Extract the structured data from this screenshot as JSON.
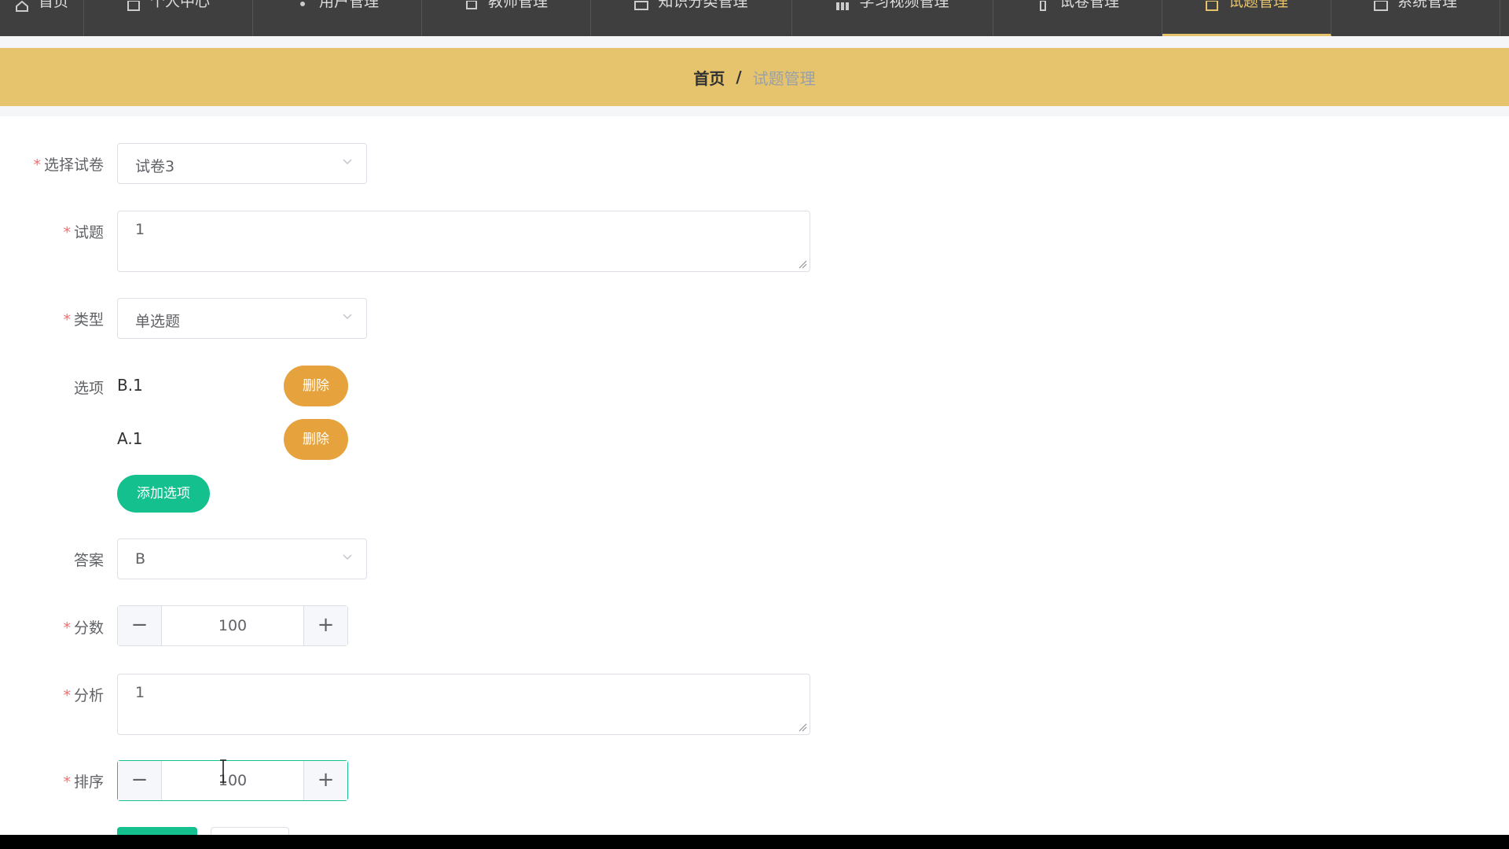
{
  "nav": [
    {
      "label": "首页",
      "icon": "home-icon"
    },
    {
      "label": "个人中心",
      "icon": "person-icon"
    },
    {
      "label": "用户管理",
      "icon": "user-icon"
    },
    {
      "label": "教师管理",
      "icon": "teacher-icon"
    },
    {
      "label": "知识分类管理",
      "icon": "category-icon"
    },
    {
      "label": "学习视频管理",
      "icon": "video-icon"
    },
    {
      "label": "试卷管理",
      "icon": "paper-icon"
    },
    {
      "label": "试题管理",
      "icon": "question-icon",
      "active": true
    },
    {
      "label": "系统管理",
      "icon": "settings-icon"
    }
  ],
  "breadcrumb": {
    "home": "首页",
    "sep": "/",
    "current": "试题管理"
  },
  "form": {
    "paper": {
      "label": "选择试卷",
      "value": "试卷3"
    },
    "question": {
      "label": "试题",
      "value": "1"
    },
    "type": {
      "label": "类型",
      "value": "单选题"
    },
    "options": {
      "label": "选项",
      "items": [
        {
          "text": "B.1",
          "delete_label": "删除"
        },
        {
          "text": "A.1",
          "delete_label": "删除"
        }
      ],
      "add_label": "添加选项"
    },
    "answer": {
      "label": "答案",
      "value": "B"
    },
    "score": {
      "label": "分数",
      "value": "100",
      "minus": "−",
      "plus": "+"
    },
    "analysis": {
      "label": "分析",
      "value": "1"
    },
    "sort": {
      "label": "排序",
      "value": "100",
      "minus": "−",
      "plus": "+"
    }
  },
  "colors": {
    "nav_bg": "#3f3f3f",
    "accent": "#e6c46d",
    "primary": "#13c08e",
    "warning": "#e6a23c",
    "required": "#f56c6c"
  }
}
